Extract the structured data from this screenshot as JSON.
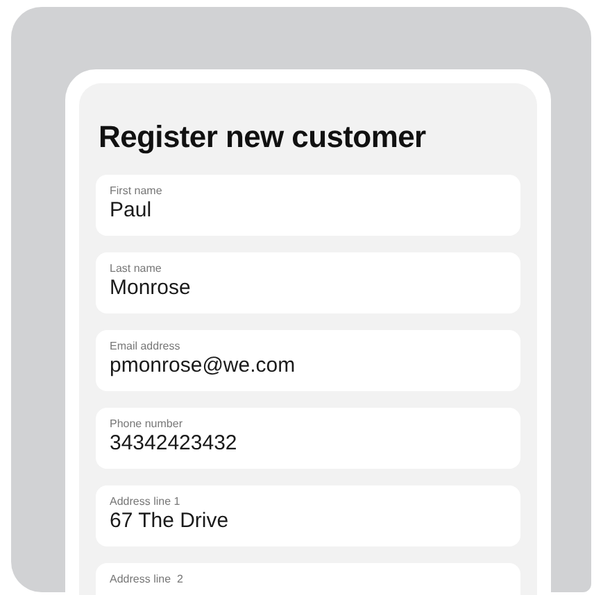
{
  "title": "Register new customer",
  "fields": [
    {
      "label": "First name",
      "value": "Paul"
    },
    {
      "label": "Last name",
      "value": "Monrose"
    },
    {
      "label": "Email address",
      "value": "pmonrose@we.com"
    },
    {
      "label": "Phone number",
      "value": "34342423432"
    },
    {
      "label": "Address line 1",
      "value": "67 The Drive"
    },
    {
      "label": "Address line  2"
    }
  ]
}
